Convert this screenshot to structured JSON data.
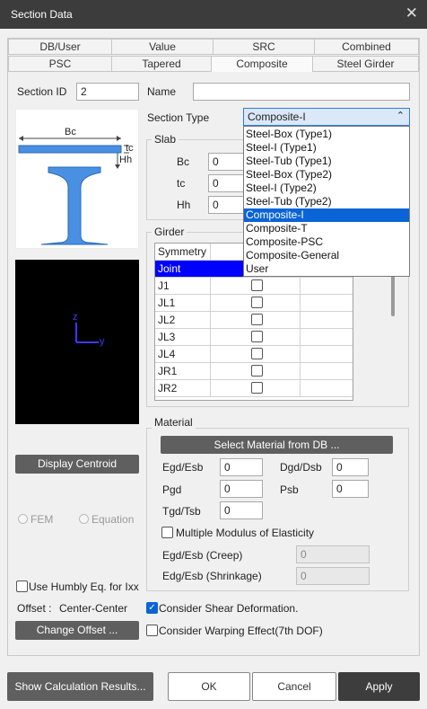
{
  "window": {
    "title": "Section Data",
    "close_glyph": "✕"
  },
  "tabs_row1": [
    "DB/User",
    "Value",
    "SRC",
    "Combined"
  ],
  "tabs_row2": [
    "PSC",
    "Tapered",
    "Composite",
    "Steel Girder"
  ],
  "section": {
    "id_label": "Section ID",
    "id_value": "2",
    "name_label": "Name",
    "name_value": "",
    "type_label": "Section Type",
    "type_value": "Composite-I"
  },
  "type_options": [
    "Steel-Box (Type1)",
    "Steel-I (Type1)",
    "Steel-Tub (Type1)",
    "Steel-Box (Type2)",
    "Steel-I (Type2)",
    "Steel-Tub (Type2)",
    "Composite-I",
    "Composite-T",
    "Composite-PSC",
    "Composite-General",
    "User"
  ],
  "diagram": {
    "bc": "Bc",
    "tc": "tc",
    "hh": "Hh",
    "axis_z": "z",
    "axis_y": "y"
  },
  "slab": {
    "title": "Slab",
    "fields": [
      {
        "label": "Bc",
        "value": "0"
      },
      {
        "label": "tc",
        "value": "0"
      },
      {
        "label": "Hh",
        "value": "0"
      }
    ]
  },
  "girder": {
    "title": "Girder",
    "header": "Symmetry",
    "selected_row": "Joint",
    "rows": [
      "J1",
      "JL1",
      "JL2",
      "JL3",
      "JL4",
      "JR1",
      "JR2"
    ]
  },
  "material": {
    "title": "Material",
    "select_button": "Select Material from DB ...",
    "egd_label": "Egd/Esb",
    "egd_value": "0",
    "dgd_label": "Dgd/Dsb",
    "dgd_value": "0",
    "pgd_label": "Pgd",
    "pgd_value": "0",
    "psb_label": "Psb",
    "psb_value": "0",
    "tgd_label": "Tgd/Tsb",
    "tgd_value": "0",
    "multi_label": "Multiple Modulus of Elasticity",
    "creep_label": "Egd/Esb (Creep)",
    "creep_value": "0",
    "shrink_label": "Edg/Esb (Shrinkage)",
    "shrink_value": "0"
  },
  "left": {
    "display_centroid": "Display Centroid",
    "fem": "FEM",
    "equation": "Equation",
    "humbly": "Use Humbly Eq. for Ixx",
    "offset_label": "Offset :",
    "offset_value": "Center-Center",
    "change_offset": "Change Offset ..."
  },
  "options": {
    "shear": "Consider Shear Deformation.",
    "warping": "Consider Warping Effect(7th DOF)"
  },
  "footer": {
    "show_calc": "Show Calculation Results...",
    "ok": "OK",
    "cancel": "Cancel",
    "apply": "Apply"
  },
  "colors": {
    "accent": "#0a64d6",
    "titlebar": "#3c3c3c",
    "selected_row": "#0000ff",
    "section_fill": "#4a90e2",
    "axis_color": "#3a3aff"
  }
}
